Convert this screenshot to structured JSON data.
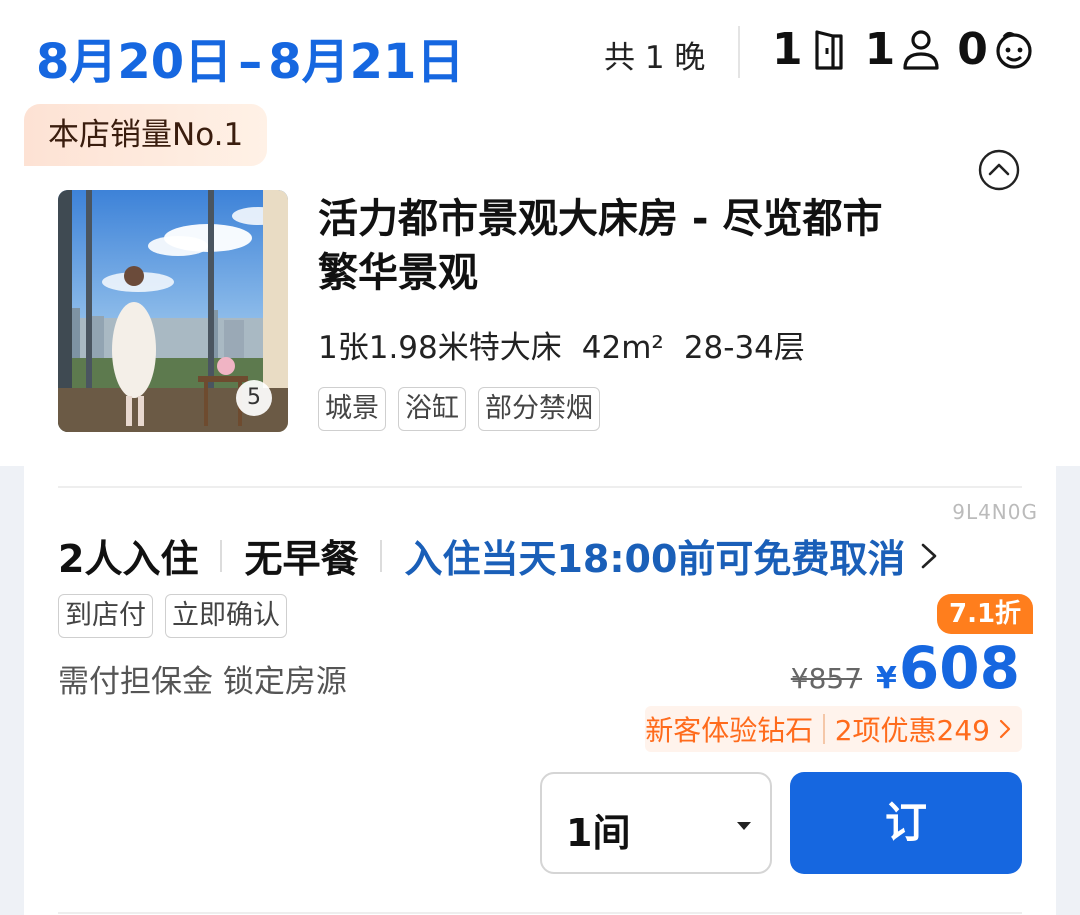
{
  "header": {
    "check_in": "8月20日",
    "separator": "–",
    "check_out": "8月21日",
    "nights": "共 1 晚",
    "rooms": "1",
    "adults": "1",
    "children": "0",
    "icons": [
      "door-icon",
      "person-icon",
      "child-icon"
    ]
  },
  "room": {
    "badge": "本店销量No.1",
    "title": "活力都市景观大床房 - 尽览都市繁华景观",
    "bed": "1张1.98米特大床",
    "area": "42m²",
    "floors": "28-34层",
    "photo_count": "5",
    "tags": [
      "城景",
      "浴缸",
      "部分禁烟"
    ]
  },
  "rate": {
    "code": "9L4N0G",
    "occupancy": "2人入住",
    "breakfast": "无早餐",
    "cancellation": "入住当天18:00前可免费取消",
    "pay_tags": [
      "到店付",
      "立即确认"
    ],
    "deposit_note": "需付担保金 锁定房源",
    "discount_badge": "7.1折",
    "original_price": "¥857",
    "currency": "¥",
    "price": "608",
    "promo_label": "新客体验钻石",
    "promo_detail": "2项优惠249",
    "quantity": "1间",
    "book_label": "订"
  },
  "colors": {
    "brand_blue": "#1667e0",
    "cancel_blue": "#1a5fb8",
    "orange": "#ff7e1d",
    "promo_text": "#ff6b1c"
  }
}
